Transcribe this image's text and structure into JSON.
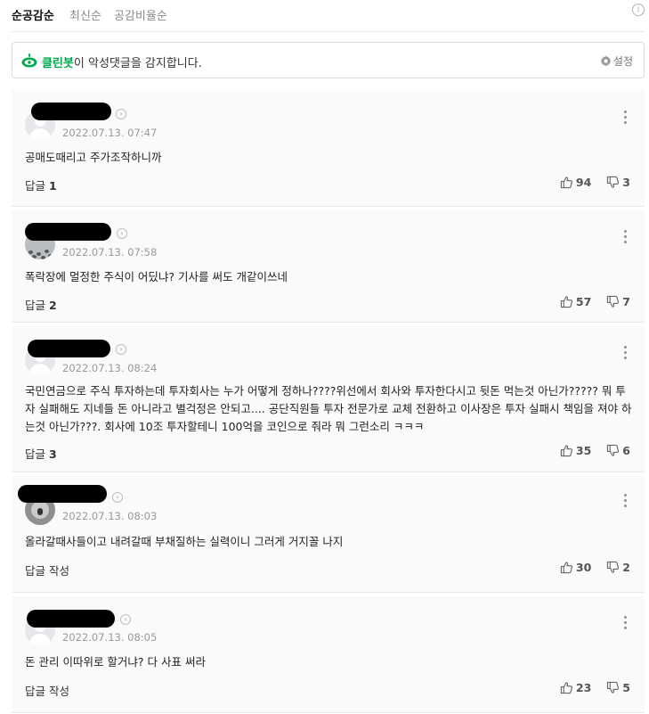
{
  "sort_tabs": [
    {
      "label": "순공감순",
      "active": true
    },
    {
      "label": "최신순",
      "active": false
    },
    {
      "label": "공감비율순",
      "active": false
    }
  ],
  "info_icon": "i",
  "cleanbot": {
    "name": "클린봇",
    "message": "이 악성댓글을 감지합니다.",
    "settings_label": "설정"
  },
  "comments": [
    {
      "date": "2022.07.13. 07:47",
      "text": "공매도때리고 주가조작하니까",
      "reply_label": "답글",
      "reply_count": "1",
      "likes": "94",
      "dislikes": "3",
      "avatar": "default"
    },
    {
      "date": "2022.07.13. 07:58",
      "text": "폭락장에 멀정한 주식이 어딨냐? 기사를 써도 개같이쓰네",
      "reply_label": "답글",
      "reply_count": "2",
      "likes": "57",
      "dislikes": "7",
      "avatar": "pattern"
    },
    {
      "date": "2022.07.13. 08:24",
      "text": "국민연금으로 주식 투자하는데 투자회사는 누가 어떻게 정하나????위선에서 회사와 투자한다시고 뒷돈 먹는것 아닌가????? 뭐 투자 실패해도 지네들 돈 아니라고 별걱정은 안되고.... 공단직원들 투자 전문가로 교체 전환하고 이사장은 투자 실패시 책임을 져야 하는것 아닌가???. 회사에 10조 투자할테니 100억을 코인으로 줘라 뭐 그런소리 ㅋㅋㅋ",
      "reply_label": "답글",
      "reply_count": "3",
      "likes": "35",
      "dislikes": "6",
      "avatar": "default"
    },
    {
      "date": "2022.07.13. 08:03",
      "text": "올라갈때사들이고 내려갈때 부채질하는 실력이니 그러게 거지꼴 나지",
      "reply_label": "답글 작성",
      "reply_count": "",
      "likes": "30",
      "dislikes": "2",
      "avatar": "koala"
    },
    {
      "date": "2022.07.13. 08:05",
      "text": "돈 관리 이따위로 할거냐? 다 사표 써라",
      "reply_label": "답글 작성",
      "reply_count": "",
      "likes": "23",
      "dislikes": "5",
      "avatar": "default"
    }
  ],
  "colors": {
    "accent": "#03a94d",
    "muted": "#999999",
    "card": "#fafafa"
  }
}
